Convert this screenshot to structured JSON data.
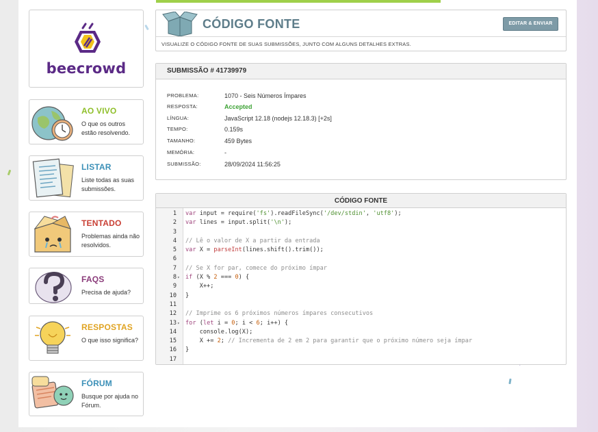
{
  "brand": {
    "name": "beecrowd"
  },
  "sidebar": {
    "items": [
      {
        "title": "AO VIVO",
        "desc": "O que os outros estão resolvendo.",
        "color": "#8fbf2a",
        "icon": "globe-clock-icon"
      },
      {
        "title": "LISTAR",
        "desc": "Liste todas as suas submissões.",
        "color": "#3a8fb7",
        "icon": "papers-list-icon"
      },
      {
        "title": "TENTADO",
        "desc": "Problemas ainda não resolvidos.",
        "color": "#c94035",
        "icon": "crying-box-icon"
      },
      {
        "title": "FAQS",
        "desc": "Precisa de ajuda?",
        "color": "#8a3b7a",
        "icon": "question-mark-icon"
      },
      {
        "title": "RESPOSTAS",
        "desc": "O que isso significa?",
        "color": "#e0a321",
        "icon": "light-bulb-icon"
      },
      {
        "title": "FÓRUM",
        "desc": "Busque por ajuda no Fórum.",
        "color": "#3a8fb7",
        "icon": "chat-bubbles-icon"
      }
    ]
  },
  "header": {
    "title": "CÓDIGO FONTE",
    "button": "EDITAR & ENVIAR",
    "subtitle": "VISUALIZE O CÓDIGO FONTE DE SUAS SUBMISSÕES, JUNTO COM ALGUNS DETALHES EXTRAS."
  },
  "submission": {
    "heading": "SUBMISSÃO # 41739979",
    "rows": [
      {
        "label": "PROBLEMA:",
        "value": "1070 - Seis Números Ímpares"
      },
      {
        "label": "RESPOSTA:",
        "value": "Accepted"
      },
      {
        "label": "LÍNGUA:",
        "value": "JavaScript 12.18 (nodejs 12.18.3) [+2s]"
      },
      {
        "label": "TEMPO:",
        "value": "0.159s"
      },
      {
        "label": "TAMANHO:",
        "value": "459 Bytes"
      },
      {
        "label": "MEMÓRIA:",
        "value": "-"
      },
      {
        "label": "SUBMISSÃO:",
        "value": "28/09/2024 11:56:25"
      }
    ]
  },
  "code": {
    "heading": "CÓDIGO FONTE",
    "lines": [
      "var input = require('fs').readFileSync('/dev/stdin', 'utf8');",
      "var lines = input.split('\\n');",
      "",
      "// Lê o valor de X a partir da entrada",
      "var X = parseInt(lines.shift().trim());",
      "",
      "// Se X for par, comece do próximo ímpar",
      "if (X % 2 === 0) {",
      "    X++;",
      "}",
      "",
      "// Imprime os 6 próximos números ímpares consecutivos",
      "for (let i = 0; i < 6; i++) {",
      "    console.log(X);",
      "    X += 2; // Incrementa de 2 em 2 para garantir que o próximo número seja ímpar",
      "}",
      ""
    ],
    "line_numbers": [
      "1",
      "2",
      "3",
      "4",
      "5",
      "6",
      "7",
      "8",
      "9",
      "10",
      "11",
      "12",
      "13",
      "14",
      "15",
      "16",
      "17"
    ]
  }
}
